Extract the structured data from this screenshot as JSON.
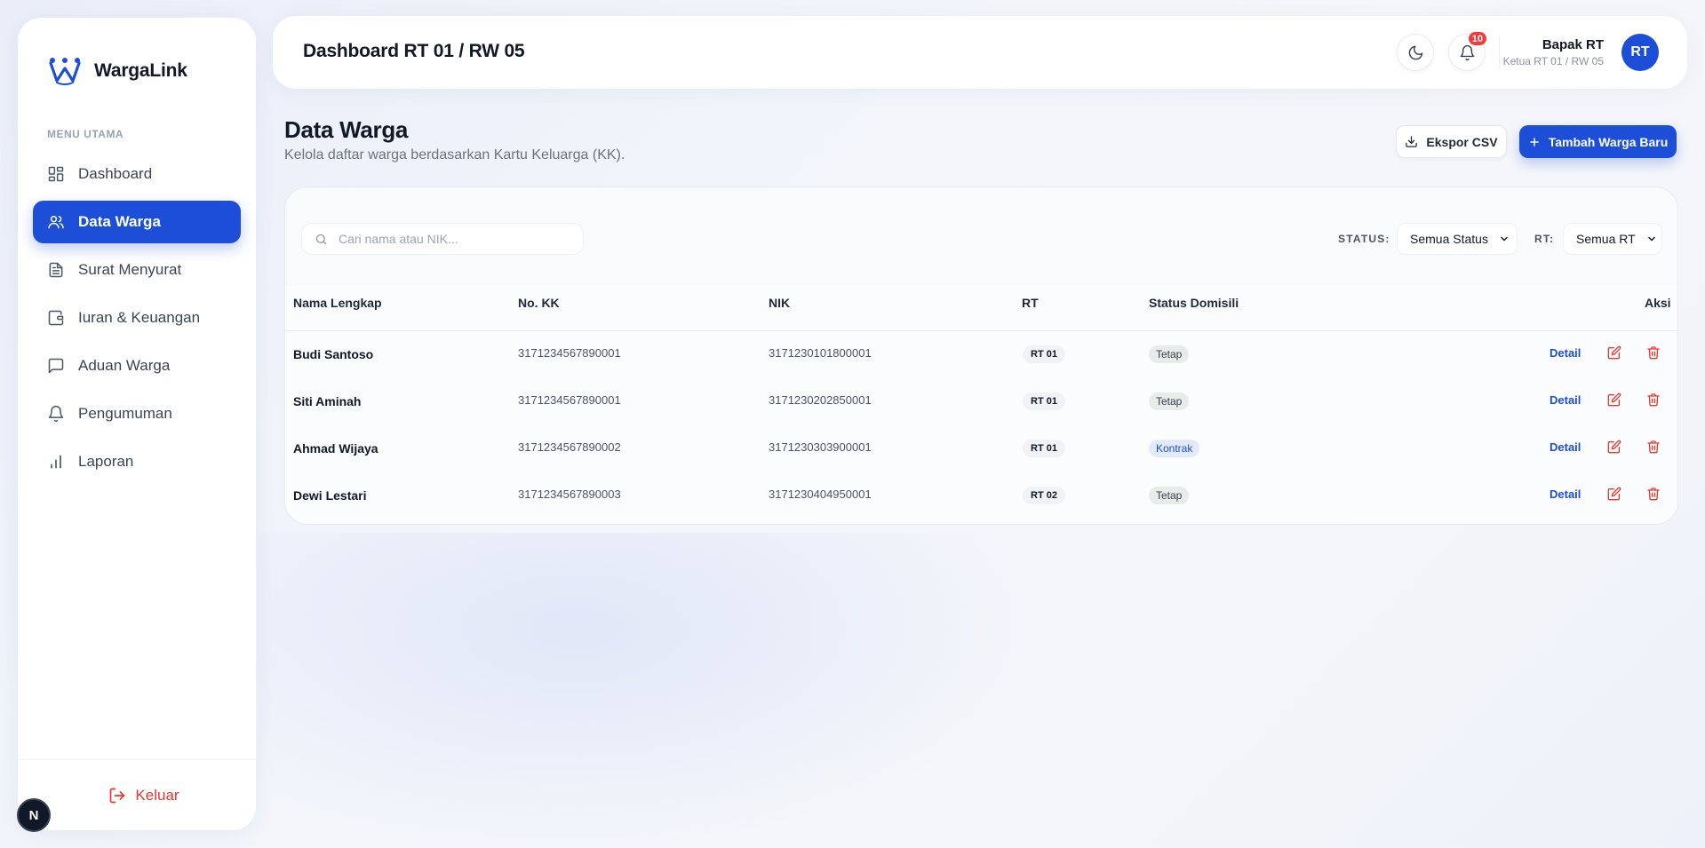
{
  "app": {
    "name": "WargaLink"
  },
  "sidebar": {
    "menu_heading": "MENU UTAMA",
    "items": [
      {
        "label": "Dashboard",
        "icon": "dashboard-icon"
      },
      {
        "label": "Data Warga",
        "icon": "users-icon",
        "active": true
      },
      {
        "label": "Surat Menyurat",
        "icon": "document-icon"
      },
      {
        "label": "Iuran & Keuangan",
        "icon": "wallet-icon"
      },
      {
        "label": "Aduan Warga",
        "icon": "message-icon"
      },
      {
        "label": "Pengumuman",
        "icon": "bell-icon"
      },
      {
        "label": "Laporan",
        "icon": "chart-icon"
      }
    ],
    "logout_label": "Keluar"
  },
  "header": {
    "title": "Dashboard RT 01 / RW 05",
    "notification_count": "10",
    "user_name": "Bapak RT",
    "user_role": "Ketua RT 01 / RW 05",
    "avatar_initials": "RT"
  },
  "page": {
    "title": "Data Warga",
    "subtitle": "Kelola daftar warga berdasarkan Kartu Keluarga (KK).",
    "export_label": "Ekspor CSV",
    "add_label": "Tambah Warga Baru"
  },
  "filters": {
    "search_placeholder": "Cari nama atau NIK...",
    "status_label": "STATUS:",
    "status_value": "Semua Status",
    "rt_label": "RT:",
    "rt_value": "Semua RT"
  },
  "table": {
    "columns": [
      "Nama Lengkap",
      "No. KK",
      "NIK",
      "RT",
      "Status Domisili",
      "Aksi"
    ],
    "detail_label": "Detail",
    "rows": [
      {
        "name": "Budi Santoso",
        "kk": "3171234567890001",
        "nik": "3171230101800001",
        "rt": "RT 01",
        "status": "Tetap"
      },
      {
        "name": "Siti Aminah",
        "kk": "3171234567890001",
        "nik": "3171230202850001",
        "rt": "RT 01",
        "status": "Tetap"
      },
      {
        "name": "Ahmad Wijaya",
        "kk": "3171234567890002",
        "nik": "3171230303900001",
        "rt": "RT 01",
        "status": "Kontrak"
      },
      {
        "name": "Dewi Lestari",
        "kk": "3171234567890003",
        "nik": "3171230404950001",
        "rt": "RT 02",
        "status": "Tetap"
      }
    ]
  },
  "dev_badge": "N",
  "colors": {
    "primary": "#1d4ed8",
    "danger": "#e5382e"
  }
}
